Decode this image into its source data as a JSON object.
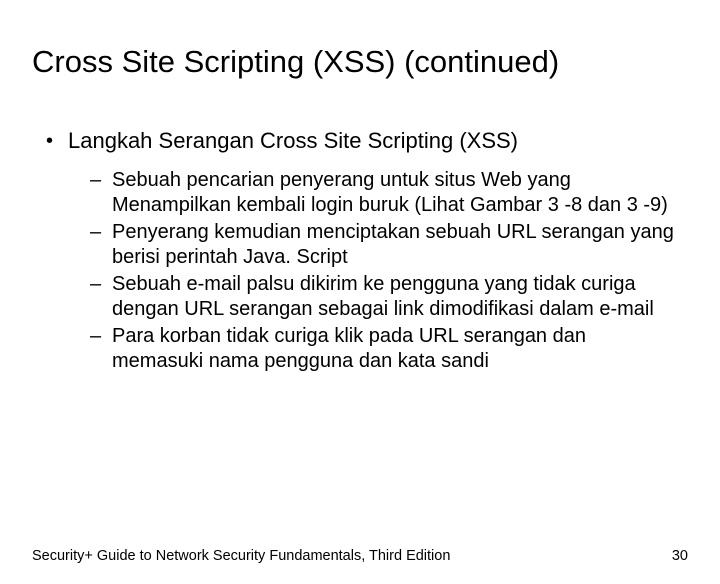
{
  "title": "Cross Site Scripting (XSS) (continued)",
  "bullet": {
    "marker": "•",
    "text": "Langkah Serangan Cross Site Scripting (XSS)"
  },
  "subs": [
    {
      "marker": "–",
      "text": "Sebuah pencarian penyerang untuk situs Web yang Menampilkan kembali login buruk (Lihat Gambar 3 -8 dan 3 -9)"
    },
    {
      "marker": "–",
      "text": "Penyerang kemudian menciptakan sebuah URL serangan yang berisi perintah Java. Script"
    },
    {
      "marker": "–",
      "text": "Sebuah e-mail palsu dikirim ke pengguna yang tidak curiga dengan URL serangan sebagai link dimodifikasi dalam e-mail"
    },
    {
      "marker": "–",
      "text": "Para korban tidak curiga klik pada URL serangan dan memasuki nama pengguna dan kata sandi"
    }
  ],
  "footer": {
    "left": "Security+ Guide to Network Security Fundamentals, Third Edition",
    "right": "30"
  }
}
